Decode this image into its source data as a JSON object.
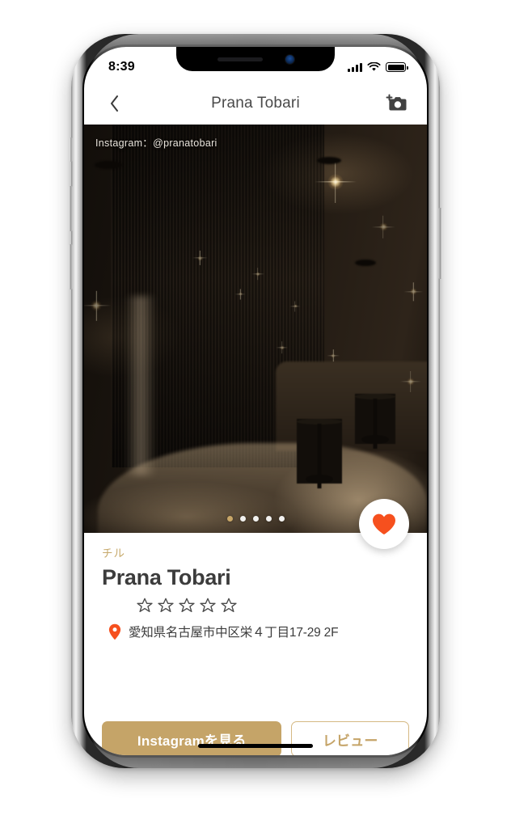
{
  "status_bar": {
    "time": "8:39",
    "signal_icon": "cellular-signal-icon",
    "wifi_icon": "wifi-icon",
    "battery_icon": "battery-icon"
  },
  "nav": {
    "back_icon": "chevron-left-icon",
    "title": "Prana Tobari",
    "camera_icon": "add-photo-camera-icon"
  },
  "hero": {
    "instagram_overlay": "Instagram：@pranatobari",
    "total_slides": 5,
    "active_slide": 1
  },
  "favorite": {
    "icon": "heart-icon",
    "color": "#F6501E",
    "active": true
  },
  "card": {
    "tag": "チル",
    "title": "Prana Tobari",
    "rating": 0,
    "max_rating": 5,
    "star_icon": "star-outline-icon",
    "location_pin_icon": "location-pin-icon",
    "address": "愛知県名古屋市中区栄４丁目17-29 2F"
  },
  "actions": {
    "primary_label": "Instagramを見る",
    "secondary_label": "レビュー",
    "primary_color": "#C5A468",
    "secondary_border_color": "#D5B983"
  },
  "theme": {
    "gold": "#C5A468",
    "tag_gold": "#C6A86A",
    "accent_orange": "#F6501E",
    "text_dark": "#3C3C3C"
  },
  "home_indicator": "home-indicator"
}
